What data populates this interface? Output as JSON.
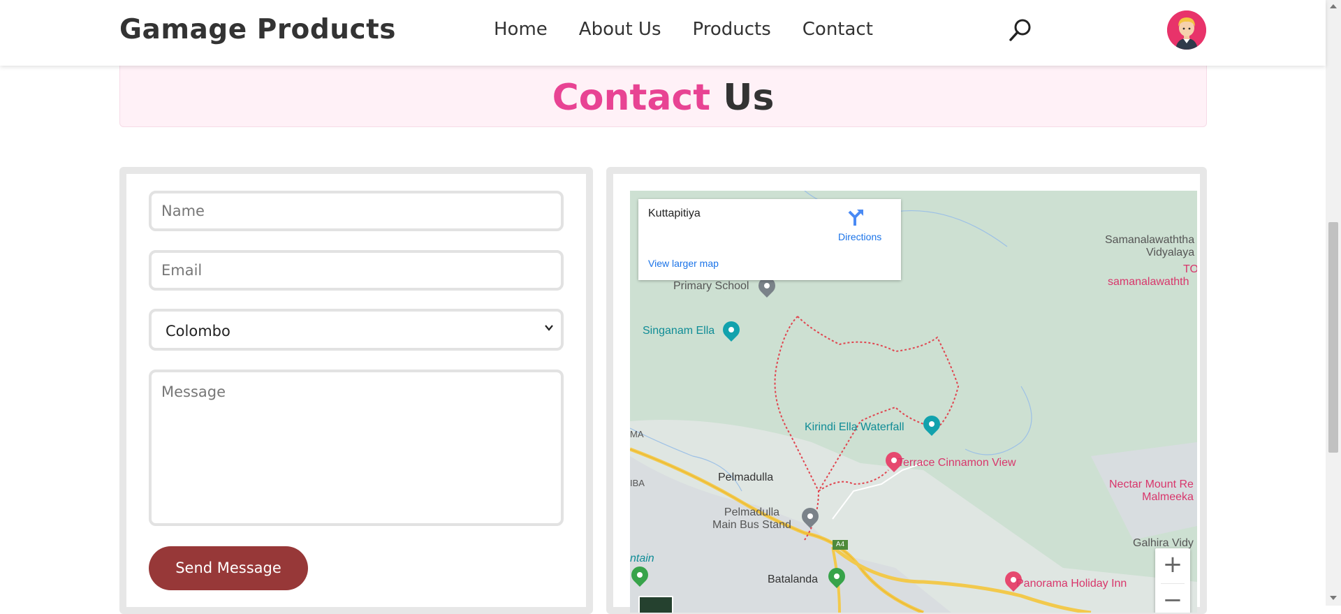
{
  "header": {
    "brand": "Gamage Products",
    "nav": [
      "Home",
      "About Us",
      "Products",
      "Contact"
    ],
    "search_icon": "search-icon",
    "avatar_icon": "user-avatar-icon"
  },
  "title": {
    "accent": "Contact",
    "rest": "Us"
  },
  "form": {
    "name_placeholder": "Name",
    "email_placeholder": "Email",
    "city_selected": "Colombo",
    "message_placeholder": "Message",
    "send_label": "Send Message"
  },
  "map": {
    "info": {
      "location": "Kuttapitiya",
      "directions": "Directions",
      "view_larger": "View larger map"
    },
    "places": {
      "primary_school": "Primary School",
      "singanam_ella": "Singanam Ella",
      "kirindi_ella": "Kirindi Ella Waterfall",
      "terrace": "Terrace Cinnamon View",
      "pelmadulla": "Pelmadulla",
      "bus_stand_1": "Pelmadulla",
      "bus_stand_2": "Main Bus Stand",
      "batalanda": "Batalanda",
      "panorama": "Panorama Holiday Inn",
      "samanala_1": "Samanalawaththa",
      "samanala_2": "Vidyalaya",
      "to": "TO",
      "samanala_3": "samanalawathth",
      "nectar_1": "Nectar Mount Re",
      "nectar_2": "Malmeeka",
      "galhira": "Galhira Vidy",
      "ma": "MA",
      "iba": "IBA",
      "ntain": "ntain",
      "a4": "A4"
    },
    "zoom_in": "+",
    "zoom_out": "−"
  },
  "colors": {
    "accent_pink": "#e84393",
    "button": "#973838",
    "title_bg": "#fff1f7"
  }
}
